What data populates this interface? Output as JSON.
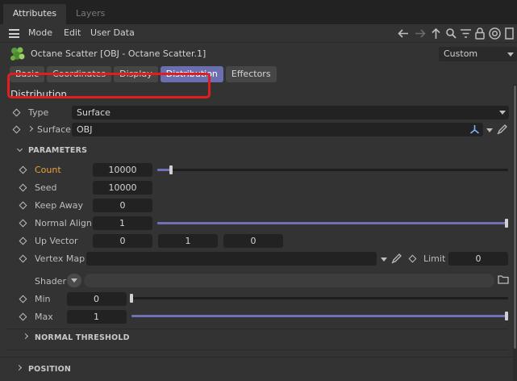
{
  "tabs": {
    "attributes": "Attributes",
    "layers": "Layers"
  },
  "menu": {
    "mode": "Mode",
    "edit": "Edit",
    "user_data": "User Data"
  },
  "object": {
    "title": "Octane Scatter [OBJ - Octane Scatter.1]",
    "preset": "Custom"
  },
  "subtabs": [
    "Basic",
    "Coordinates",
    "Display",
    "Distribution",
    "Effectors"
  ],
  "section": "Distribution",
  "type": {
    "label": "Type",
    "value": "Surface"
  },
  "surface": {
    "label": "Surface",
    "value": "OBJ"
  },
  "parameters": {
    "title": "PARAMETERS",
    "count": {
      "label": "Count",
      "value": "10000",
      "slider": 0.04
    },
    "seed": {
      "label": "Seed",
      "value": "10000"
    },
    "keep_away": {
      "label": "Keep Away",
      "value": "0"
    },
    "normal_align": {
      "label": "Normal Align",
      "value": "1",
      "slider": 1.0
    },
    "up_vector": {
      "label": "Up Vector",
      "x": "0",
      "y": "1",
      "z": "0"
    },
    "vertex_map": {
      "label": "Vertex Map",
      "value": "",
      "limit_label": "Limit",
      "limit_value": "0"
    },
    "shader": {
      "label": "Shader",
      "value": ""
    },
    "min": {
      "label": "Min",
      "value": "0",
      "slider": 0.0
    },
    "max": {
      "label": "Max",
      "value": "1",
      "slider": 1.0
    }
  },
  "groups": {
    "normal_threshold": "NORMAL THRESHOLD",
    "position": "POSITION"
  },
  "colors": {
    "accent": "#6b6fb0",
    "highlight": "#e01e1e",
    "count_label": "#e9a23b"
  }
}
